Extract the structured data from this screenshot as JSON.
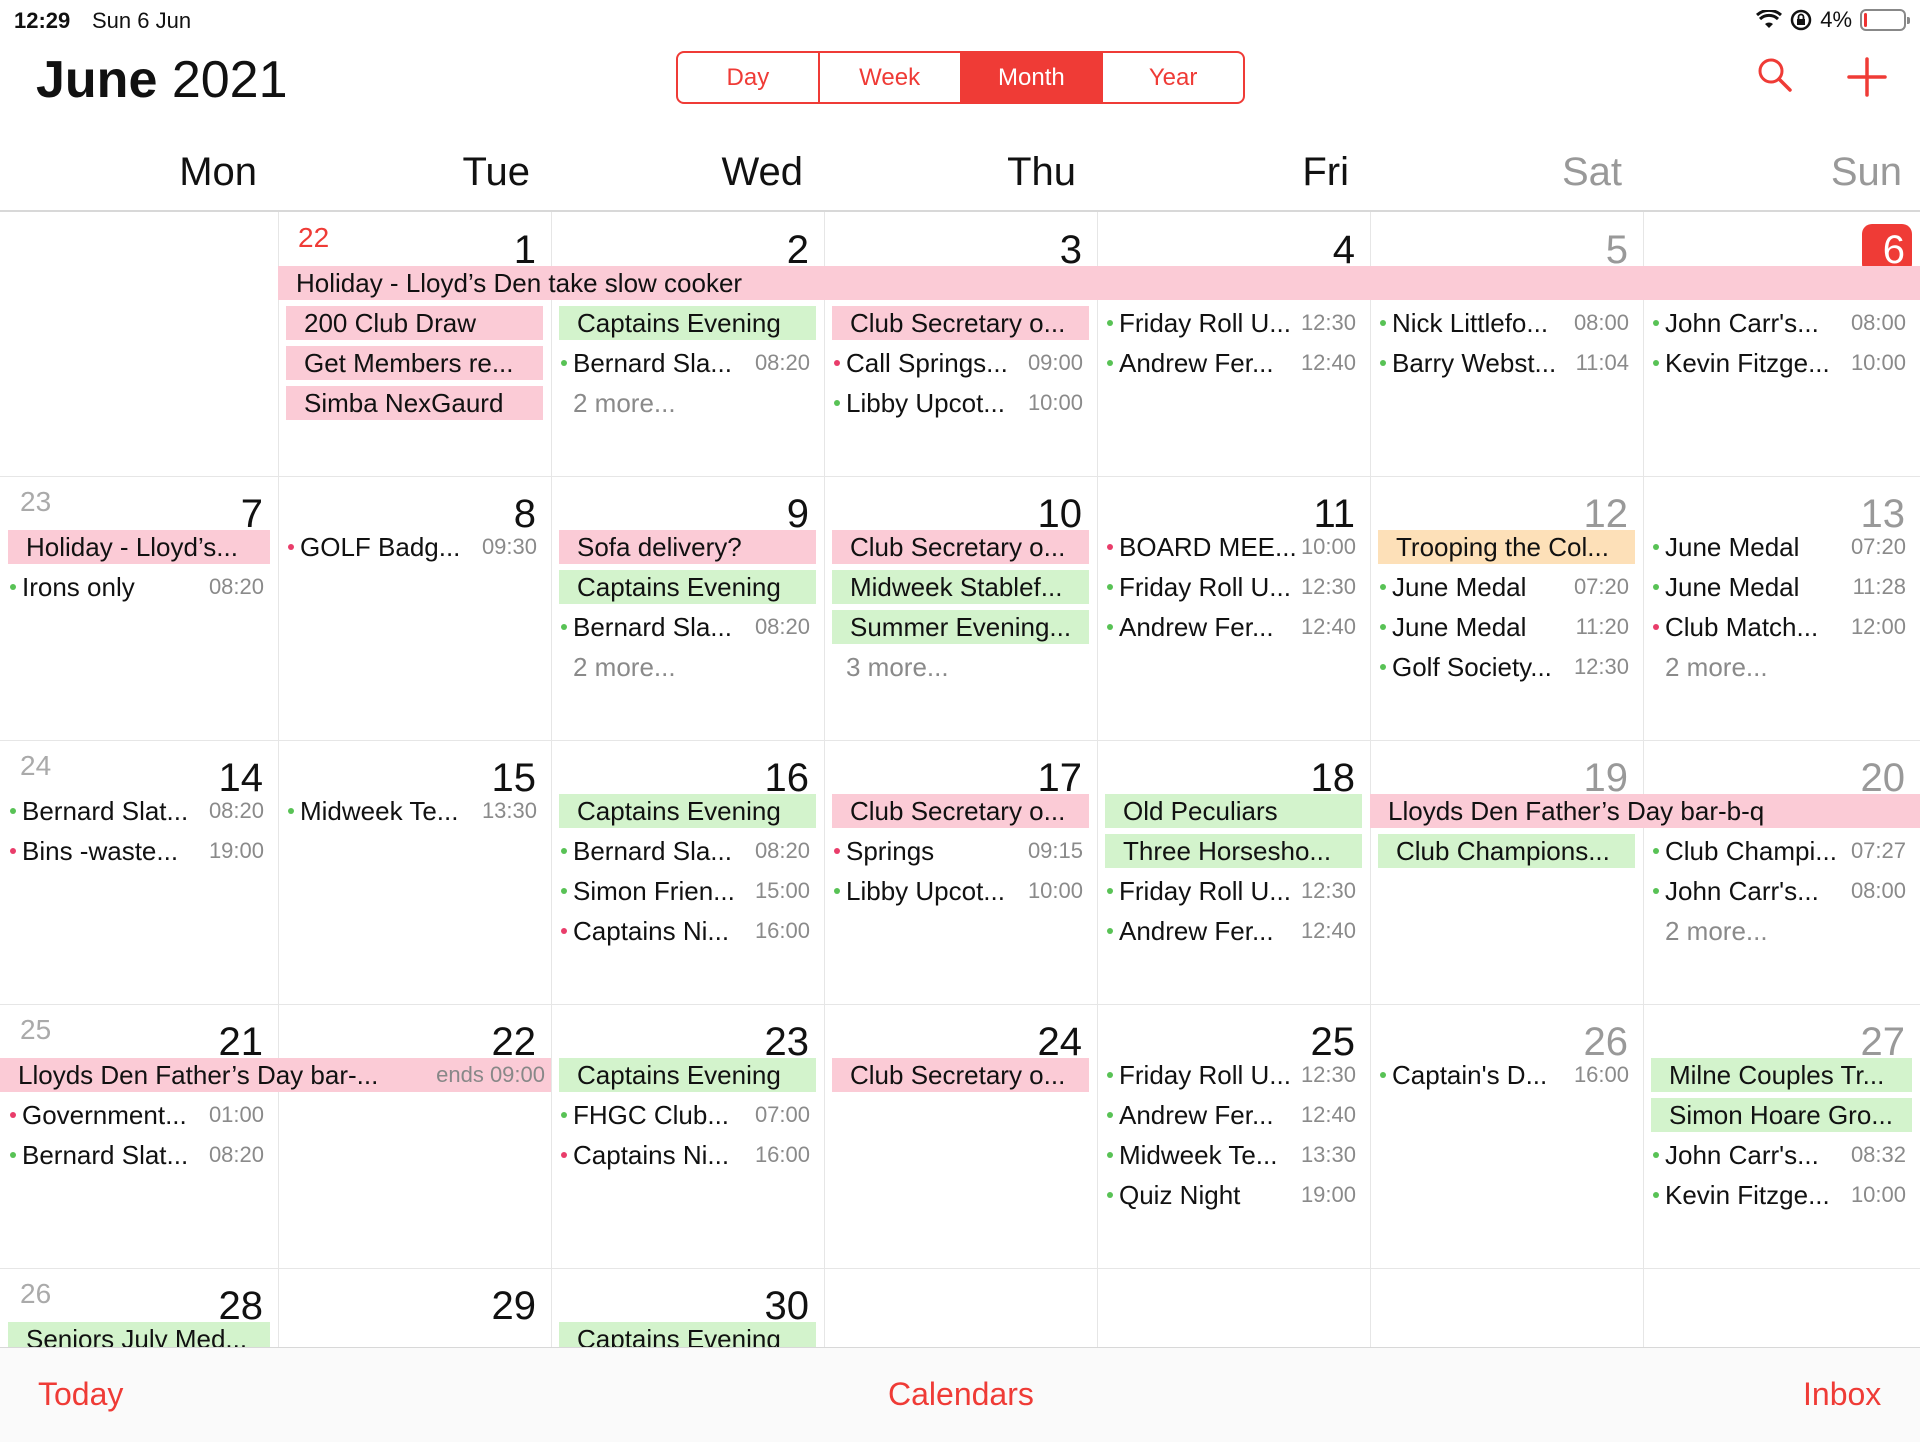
{
  "status": {
    "time": "12:29",
    "date": "Sun 6 Jun",
    "battery": "4%"
  },
  "header": {
    "month": "June",
    "year": "2021",
    "search_icon": "search-icon",
    "add_icon": "plus-icon"
  },
  "view_switcher": [
    "Day",
    "Week",
    "Month",
    "Year"
  ],
  "active_view": "Month",
  "weekdays": [
    "Mon",
    "Tue",
    "Wed",
    "Thu",
    "Fri",
    "Sat",
    "Sun"
  ],
  "weeks": [
    {
      "weeknum": "22",
      "days": [
        "",
        "1",
        "2",
        "3",
        "4",
        "5",
        "6"
      ],
      "bars": [
        {
          "text": "Holiday - Lloyd’s Den take slow cooker",
          "color": "pink",
          "start": 1,
          "span": 6,
          "row": 0
        },
        {
          "text": "200 Club Draw",
          "color": "pink",
          "start": 1,
          "span": 1,
          "row": 1
        },
        {
          "text": "Get Members re...",
          "color": "pink",
          "start": 1,
          "span": 1,
          "row": 2
        },
        {
          "text": "Simba NexGaurd",
          "color": "pink",
          "start": 1,
          "span": 1,
          "row": 3
        },
        {
          "text": "Captains Evening",
          "color": "green",
          "start": 2,
          "span": 1,
          "row": 1
        },
        {
          "text": "Club Secretary o...",
          "color": "pink",
          "start": 3,
          "span": 1,
          "row": 1
        }
      ],
      "events": [
        {
          "day": 2,
          "row": 2,
          "title": "Bernard Sla...",
          "time": "08:20",
          "dot": "g"
        },
        {
          "day": 3,
          "row": 2,
          "title": "Call Springs...",
          "time": "09:00",
          "dot": "r"
        },
        {
          "day": 3,
          "row": 3,
          "title": "Libby Upcot...",
          "time": "10:00",
          "dot": "g"
        },
        {
          "day": 4,
          "row": 1,
          "title": "Friday Roll U...",
          "time": "12:30",
          "dot": "g"
        },
        {
          "day": 4,
          "row": 2,
          "title": "Andrew Fer...",
          "time": "12:40",
          "dot": "g"
        },
        {
          "day": 5,
          "row": 1,
          "title": "Nick Littlefo...",
          "time": "08:00",
          "dot": "g"
        },
        {
          "day": 5,
          "row": 2,
          "title": "Barry Webst...",
          "time": "11:04",
          "dot": "g"
        },
        {
          "day": 6,
          "row": 1,
          "title": "John Carr's...",
          "time": "08:00",
          "dot": "g"
        },
        {
          "day": 6,
          "row": 2,
          "title": "Kevin  Fitzge...",
          "time": "10:00",
          "dot": "g"
        }
      ],
      "more": [
        {
          "day": 2,
          "row": 3,
          "text": "2 more..."
        }
      ]
    },
    {
      "weeknum": "23",
      "days": [
        "7",
        "8",
        "9",
        "10",
        "11",
        "12",
        "13"
      ],
      "bars": [
        {
          "text": "Holiday - Lloyd’s...",
          "color": "pink",
          "start": 0,
          "span": 1,
          "row": 0
        },
        {
          "text": "Sofa delivery?",
          "color": "pink",
          "start": 2,
          "span": 1,
          "row": 0
        },
        {
          "text": "Captains Evening",
          "color": "green",
          "start": 2,
          "span": 1,
          "row": 1
        },
        {
          "text": "Club Secretary o...",
          "color": "pink",
          "start": 3,
          "span": 1,
          "row": 0
        },
        {
          "text": "Midweek Stablef...",
          "color": "green",
          "start": 3,
          "span": 1,
          "row": 1
        },
        {
          "text": "Summer Evening...",
          "color": "green",
          "start": 3,
          "span": 1,
          "row": 2
        },
        {
          "text": "Trooping the Col...",
          "color": "orange",
          "start": 5,
          "span": 1,
          "row": 0
        }
      ],
      "events": [
        {
          "day": 0,
          "row": 1,
          "title": "Irons only",
          "time": "08:20",
          "dot": "g"
        },
        {
          "day": 1,
          "row": 0,
          "title": "GOLF Badg...",
          "time": "09:30",
          "dot": "r"
        },
        {
          "day": 2,
          "row": 2,
          "title": "Bernard Sla...",
          "time": "08:20",
          "dot": "g"
        },
        {
          "day": 4,
          "row": 0,
          "title": "BOARD MEE...",
          "time": "10:00",
          "dot": "r"
        },
        {
          "day": 4,
          "row": 1,
          "title": "Friday Roll U...",
          "time": "12:30",
          "dot": "g"
        },
        {
          "day": 4,
          "row": 2,
          "title": "Andrew Fer...",
          "time": "12:40",
          "dot": "g"
        },
        {
          "day": 5,
          "row": 1,
          "title": "June Medal",
          "time": "07:20",
          "dot": "g"
        },
        {
          "day": 5,
          "row": 2,
          "title": "June Medal",
          "time": "11:20",
          "dot": "g"
        },
        {
          "day": 5,
          "row": 3,
          "title": "Golf Society...",
          "time": "12:30",
          "dot": "g"
        },
        {
          "day": 6,
          "row": 0,
          "title": "June Medal",
          "time": "07:20",
          "dot": "g"
        },
        {
          "day": 6,
          "row": 1,
          "title": "June Medal",
          "time": "11:28",
          "dot": "g"
        },
        {
          "day": 6,
          "row": 2,
          "title": "Club Match...",
          "time": "12:00",
          "dot": "r"
        }
      ],
      "more": [
        {
          "day": 2,
          "row": 3,
          "text": "2 more..."
        },
        {
          "day": 3,
          "row": 3,
          "text": "3 more..."
        },
        {
          "day": 6,
          "row": 3,
          "text": "2 more..."
        }
      ]
    },
    {
      "weeknum": "24",
      "days": [
        "14",
        "15",
        "16",
        "17",
        "18",
        "19",
        "20"
      ],
      "bars": [
        {
          "text": "Captains Evening",
          "color": "green",
          "start": 2,
          "span": 1,
          "row": 0
        },
        {
          "text": "Club Secretary o...",
          "color": "pink",
          "start": 3,
          "span": 1,
          "row": 0
        },
        {
          "text": "Old Peculiars",
          "color": "green",
          "start": 4,
          "span": 1,
          "row": 0
        },
        {
          "text": "Three Horsesho...",
          "color": "green",
          "start": 4,
          "span": 1,
          "row": 1
        },
        {
          "text": "Lloyds Den Father’s Day bar-b-q",
          "color": "pink",
          "start": 5,
          "span": 2,
          "row": 0
        },
        {
          "text": "Club Champions...",
          "color": "green",
          "start": 5,
          "span": 1,
          "row": 1
        }
      ],
      "events": [
        {
          "day": 0,
          "row": 0,
          "title": "Bernard Slat...",
          "time": "08:20",
          "dot": "g"
        },
        {
          "day": 0,
          "row": 1,
          "title": "Bins -waste...",
          "time": "19:00",
          "dot": "r"
        },
        {
          "day": 1,
          "row": 0,
          "title": "Midweek Te...",
          "time": "13:30",
          "dot": "g"
        },
        {
          "day": 2,
          "row": 1,
          "title": "Bernard Sla...",
          "time": "08:20",
          "dot": "g"
        },
        {
          "day": 2,
          "row": 2,
          "title": "Simon Frien...",
          "time": "15:00",
          "dot": "g"
        },
        {
          "day": 2,
          "row": 3,
          "title": "Captains Ni...",
          "time": "16:00",
          "dot": "r"
        },
        {
          "day": 3,
          "row": 1,
          "title": "Springs",
          "time": "09:15",
          "dot": "r"
        },
        {
          "day": 3,
          "row": 2,
          "title": "Libby Upcot...",
          "time": "10:00",
          "dot": "g"
        },
        {
          "day": 4,
          "row": 2,
          "title": "Friday Roll U...",
          "time": "12:30",
          "dot": "g"
        },
        {
          "day": 4,
          "row": 3,
          "title": "Andrew Fer...",
          "time": "12:40",
          "dot": "g"
        },
        {
          "day": 6,
          "row": 1,
          "title": "Club Champi...",
          "time": "07:27",
          "dot": "g"
        },
        {
          "day": 6,
          "row": 2,
          "title": "John Carr's...",
          "time": "08:00",
          "dot": "g"
        }
      ],
      "more": [
        {
          "day": 6,
          "row": 3,
          "text": "2 more..."
        }
      ]
    },
    {
      "weeknum": "25",
      "days": [
        "21",
        "22",
        "23",
        "24",
        "25",
        "26",
        "27"
      ],
      "bars": [
        {
          "text": "Lloyds Den Father’s Day bar-...",
          "ends": "ends 09:00",
          "color": "pink",
          "start": 0,
          "span": 2,
          "row": 0
        },
        {
          "text": "Captains Evening",
          "color": "green",
          "start": 2,
          "span": 1,
          "row": 0
        },
        {
          "text": "Club Secretary o...",
          "color": "pink",
          "start": 3,
          "span": 1,
          "row": 0
        },
        {
          "text": "Milne Couples Tr...",
          "color": "green",
          "start": 6,
          "span": 1,
          "row": 0
        },
        {
          "text": "Simon Hoare Gro...",
          "color": "green",
          "start": 6,
          "span": 1,
          "row": 1
        }
      ],
      "events": [
        {
          "day": 0,
          "row": 1,
          "title": "Government...",
          "time": "01:00",
          "dot": "r"
        },
        {
          "day": 0,
          "row": 2,
          "title": "Bernard Slat...",
          "time": "08:20",
          "dot": "g"
        },
        {
          "day": 2,
          "row": 1,
          "title": "FHGC Club...",
          "time": "07:00",
          "dot": "g"
        },
        {
          "day": 2,
          "row": 2,
          "title": "Captains Ni...",
          "time": "16:00",
          "dot": "r"
        },
        {
          "day": 4,
          "row": 0,
          "title": "Friday Roll U...",
          "time": "12:30",
          "dot": "g"
        },
        {
          "day": 4,
          "row": 1,
          "title": "Andrew Fer...",
          "time": "12:40",
          "dot": "g"
        },
        {
          "day": 4,
          "row": 2,
          "title": "Midweek Te...",
          "time": "13:30",
          "dot": "g"
        },
        {
          "day": 4,
          "row": 3,
          "title": "Quiz Night",
          "time": "19:00",
          "dot": "g"
        },
        {
          "day": 5,
          "row": 0,
          "title": "Captain's D...",
          "time": "16:00",
          "dot": "g"
        },
        {
          "day": 6,
          "row": 2,
          "title": "John Carr's...",
          "time": "08:32",
          "dot": "g"
        },
        {
          "day": 6,
          "row": 3,
          "title": "Kevin  Fitzge...",
          "time": "10:00",
          "dot": "g"
        }
      ],
      "more": []
    },
    {
      "weeknum": "26",
      "days": [
        "28",
        "29",
        "30",
        "",
        "",
        "",
        ""
      ],
      "bars": [
        {
          "text": "Seniors July Med...",
          "color": "green",
          "start": 0,
          "span": 1,
          "row": 0
        },
        {
          "text": "Captains Evening",
          "color": "green",
          "start": 2,
          "span": 1,
          "row": 0
        }
      ],
      "events": [],
      "more": []
    }
  ],
  "toolbar": {
    "today": "Today",
    "calendars": "Calendars",
    "inbox": "Inbox"
  }
}
